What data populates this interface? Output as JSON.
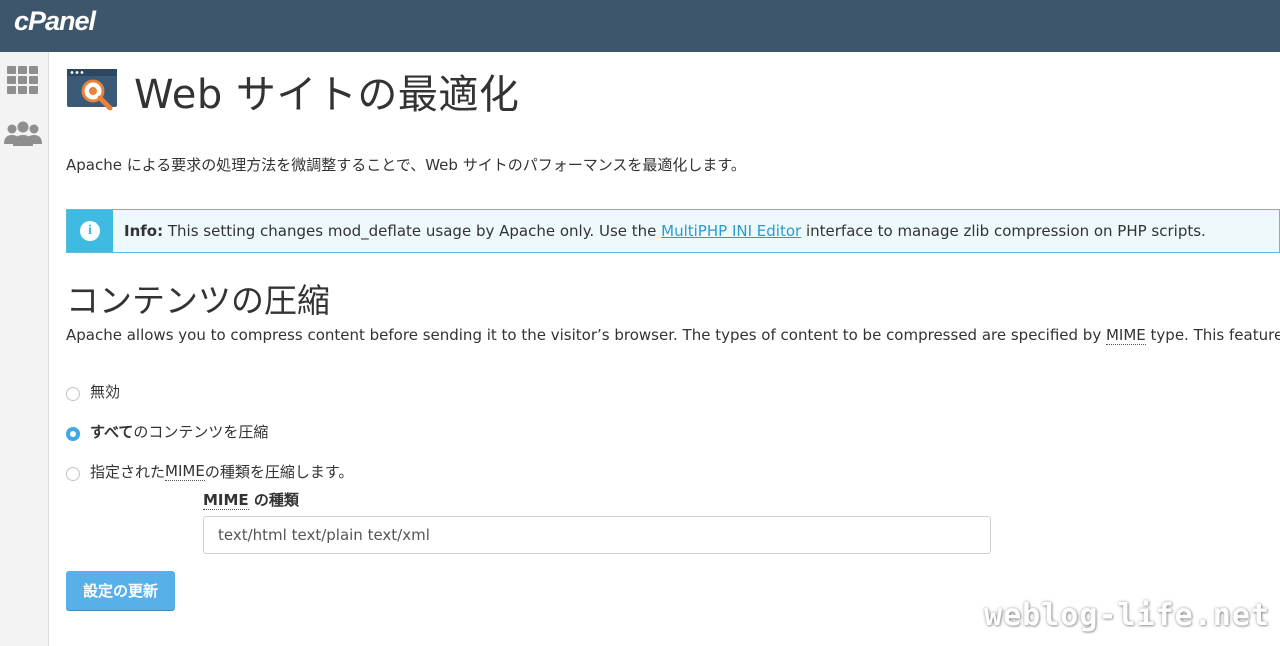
{
  "header": {
    "logo": "cPanel"
  },
  "sidebar": {
    "items": [
      {
        "icon": "grid-icon"
      },
      {
        "icon": "users-icon"
      }
    ]
  },
  "page": {
    "title": "Web サイトの最適化",
    "description": "Apache による要求の処理方法を微調整することで、Web サイトのパフォーマンスを最適化します。"
  },
  "info": {
    "label": "Info:",
    "text_before": " This setting changes mod_deflate usage by Apache only. Use the ",
    "link": "MultiPHP INI Editor",
    "text_after": " interface to manage zlib compression on PHP scripts."
  },
  "compression": {
    "title": "コンテンツの圧縮",
    "desc_before": "Apache allows you to compress content before sending it to the visitor’s browser. The types of content to be compressed are specified by ",
    "desc_abbr": "MIME",
    "desc_after": " type. This feature req",
    "options": [
      {
        "label": "無効",
        "checked": false
      },
      {
        "label_bold": "すべて",
        "label": "のコンテンツを圧縮",
        "checked": true
      },
      {
        "label_before": "指定された ",
        "label_abbr": "MIME",
        "label_after": " の種類を圧縮します。",
        "checked": false
      }
    ],
    "mime_label_abbr": "MIME",
    "mime_label_after": " の種類",
    "mime_value": "text/html text/plain text/xml",
    "submit_label": "設定の更新"
  },
  "watermark": "weblog-life.net",
  "colors": {
    "header_bg": "#3e566c",
    "info_accent": "#3fbae1",
    "button_bg": "#57b0e8",
    "link": "#2a9bd1"
  }
}
